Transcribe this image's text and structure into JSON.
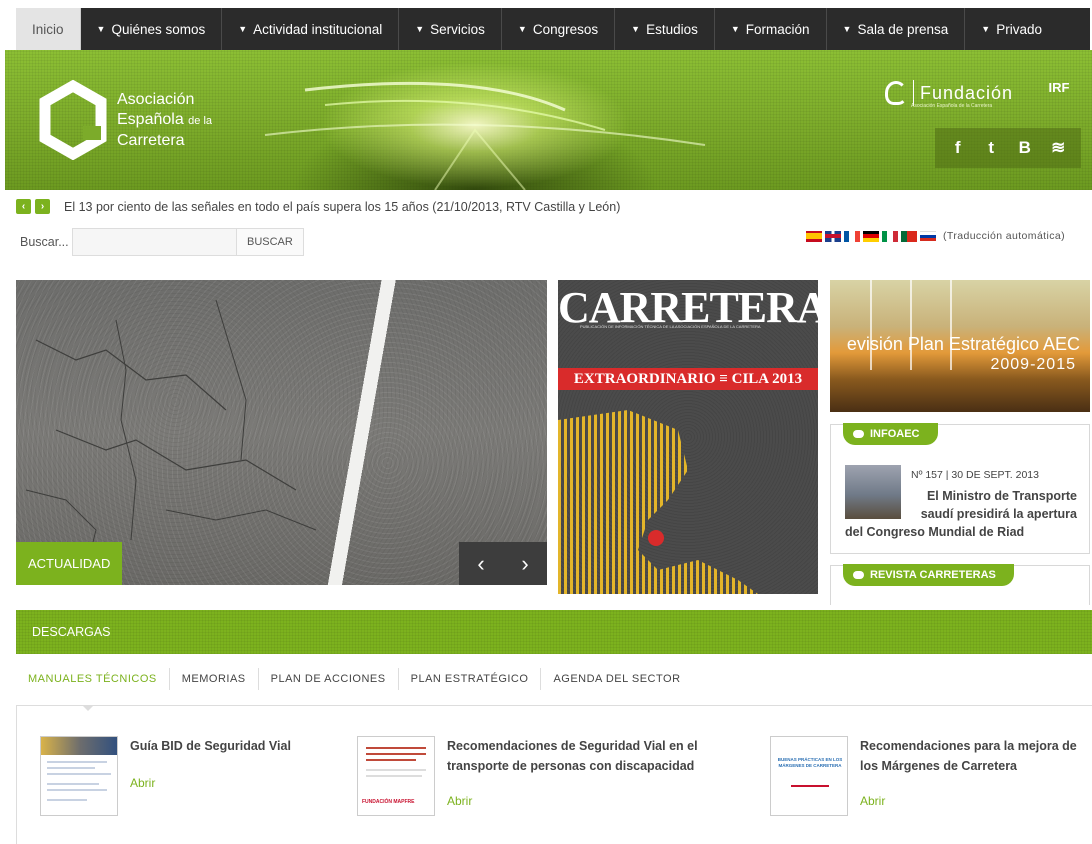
{
  "nav": [
    {
      "label": "Inicio",
      "caret": false,
      "active": true
    },
    {
      "label": "Quiénes somos",
      "caret": true
    },
    {
      "label": "Actividad institucional",
      "caret": true
    },
    {
      "label": "Servicios",
      "caret": true
    },
    {
      "label": "Congresos",
      "caret": true
    },
    {
      "label": "Estudios",
      "caret": true
    },
    {
      "label": "Formación",
      "caret": true
    },
    {
      "label": "Sala de prensa",
      "caret": true
    },
    {
      "label": "Privado",
      "caret": true
    }
  ],
  "logo": {
    "line1": "Asociación",
    "line2": "Española",
    "line2_small": "de la",
    "line3": "Carretera"
  },
  "fundacion": {
    "label": "Fundación",
    "sub": "Asociación Española de la Carretera"
  },
  "irf": "IRF",
  "social": [
    {
      "name": "facebook-icon",
      "glyph": "f"
    },
    {
      "name": "twitter-icon",
      "glyph": "t"
    },
    {
      "name": "blogger-icon",
      "glyph": "B"
    },
    {
      "name": "rss-icon",
      "glyph": "≋"
    }
  ],
  "ticker": {
    "prev": "‹",
    "next": "›",
    "text": "El 13 por ciento de las señales en todo el país supera los 15 años (21/10/2013, RTV Castilla y León)"
  },
  "search": {
    "label": "Buscar...",
    "button": "BUSCAR",
    "value": "",
    "placeholder": ""
  },
  "translation": "(Traducción automática)",
  "slider": {
    "label": "ACTUALIDAD",
    "prev": "‹",
    "next": "›"
  },
  "magazine": {
    "title": "CARRETERAS",
    "subtitle": "PUBLICACIÓN DE INFORMACIÓN TÉCNICA DE LA ASOCIACIÓN ESPAÑOLA DE LA CARRETERA",
    "banner": "EXTRAORDINARIO ≡ CILA 2013"
  },
  "plan": {
    "line1": "evisión Plan Estratégico AEC",
    "line2": "2009-2015"
  },
  "infoaec": {
    "tag": "INFOAEC",
    "meta": "Nº 157  | 30 DE SEPT. 2013",
    "title_a": "El Ministro de Transporte",
    "title_b": "saudí presidirá la apertura",
    "title_c": "del Congreso Mundial de Riad"
  },
  "revista": {
    "tag": "REVISTA CARRETERAS"
  },
  "downloads": {
    "title": "DESCARGAS",
    "tabs": [
      "MANUALES TÉCNICOS",
      "MEMORIAS",
      "PLAN DE ACCIONES",
      "PLAN ESTRATÉGICO",
      "AGENDA DEL SECTOR"
    ],
    "docs": [
      {
        "title": "Guía BID de Seguridad Vial",
        "link": "Abrir"
      },
      {
        "title": "Recomendaciones de Seguridad Vial en el transporte de personas con discapacidad",
        "link": "Abrir",
        "thumb_text": "FUNDACIÓN MAPFRE"
      },
      {
        "title": "Recomendaciones para la mejora de los Márgenes de Carretera",
        "link": "Abrir",
        "thumb_text": "BUENAS PRÁCTICAS EN LOS MÁRGENES DE CARRETERA"
      }
    ]
  },
  "colors": {
    "accent": "#7cb21e",
    "nav_bg": "#2b2b2b"
  }
}
